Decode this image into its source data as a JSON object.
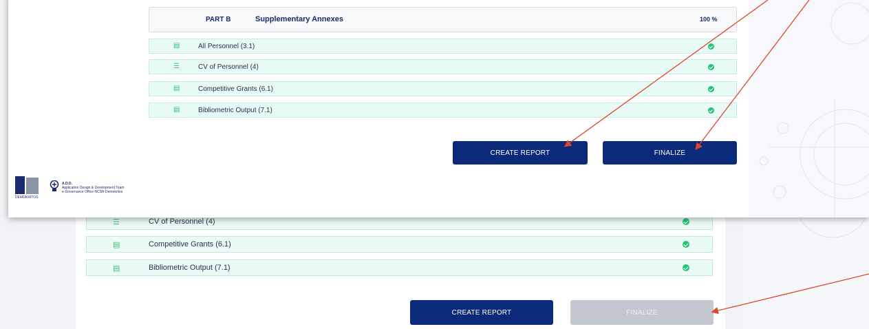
{
  "background_screen": {
    "rows": [
      {
        "label": "CV of Personnel (4)",
        "icon": "list-icon"
      },
      {
        "label": "Competitive Grants (6.1)",
        "icon": "document-icon"
      },
      {
        "label": "Bibliometric Output (7.1)",
        "icon": "document-icon"
      }
    ],
    "create_report_label": "CREATE REPORT",
    "finalize_label": "FINALIZE"
  },
  "foreground_screen": {
    "part": {
      "tag": "PART B",
      "title": "Supplementary Annexes",
      "progress": "100 %"
    },
    "rows": [
      {
        "label": "All Personnel (3.1)",
        "icon": "document-icon"
      },
      {
        "label": "CV of Personnel (4)",
        "icon": "list-icon"
      },
      {
        "label": "Competitive Grants (6.1)",
        "icon": "document-icon"
      },
      {
        "label": "Bibliometric Output (7.1)",
        "icon": "document-icon"
      }
    ],
    "create_report_label": "CREATE REPORT",
    "finalize_label": "FINALIZE",
    "footer": {
      "logo_text": "DEMOKRITOS",
      "team_short": "A.D.D.",
      "team_name": "Application Design & Development Team",
      "office": "e-Governance Office NCSR Demokritos"
    }
  },
  "colors": {
    "navy": "#0b2a7a",
    "row_bg": "#e8faf5",
    "check": "#27c277",
    "arrow": "#e0452c",
    "disabled": "#c2c7d0"
  }
}
